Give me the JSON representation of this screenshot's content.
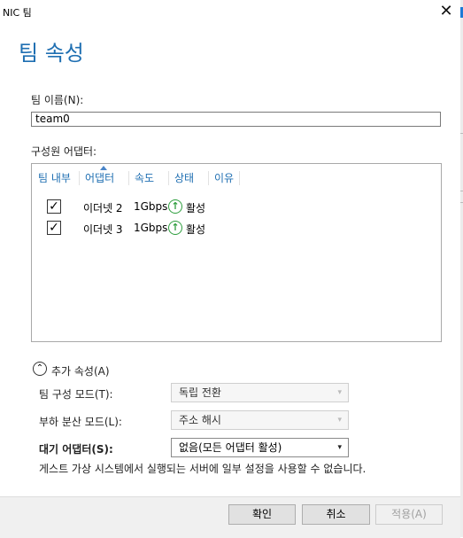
{
  "window": {
    "title": "NIC 팀"
  },
  "page": {
    "heading": "팀 속성"
  },
  "team_name": {
    "label": "팀 이름(N):",
    "value": "team0"
  },
  "members": {
    "label": "구성원 어댑터:",
    "columns": [
      "팀 내부",
      "어댑터",
      "속도",
      "상태",
      "이유"
    ],
    "rows": [
      {
        "checked": true,
        "adapter": "이더넷 2",
        "speed": "1Gbps",
        "status": "활성"
      },
      {
        "checked": true,
        "adapter": "이더넷 3",
        "speed": "1Gbps",
        "status": "활성"
      }
    ]
  },
  "additional": {
    "toggle_label": "추가 속성(A)",
    "teaming_mode": {
      "label": "팀 구성 모드(T):",
      "value": "독립 전환"
    },
    "load_balancing": {
      "label": "부하 분산 모드(L):",
      "value": "주소 해시"
    },
    "standby": {
      "label": "대기 어댑터(S):",
      "value": "없음(모든 어댑터 활성)"
    },
    "note": "게스트 가상 시스템에서 실행되는 서버에 일부 설정을 사용할 수 없습니다."
  },
  "buttons": {
    "ok": "확인",
    "cancel": "취소",
    "apply": "적용(A)"
  },
  "colors": {
    "heading": "#1f6fb2",
    "status_ok": "#2e9e3e"
  }
}
